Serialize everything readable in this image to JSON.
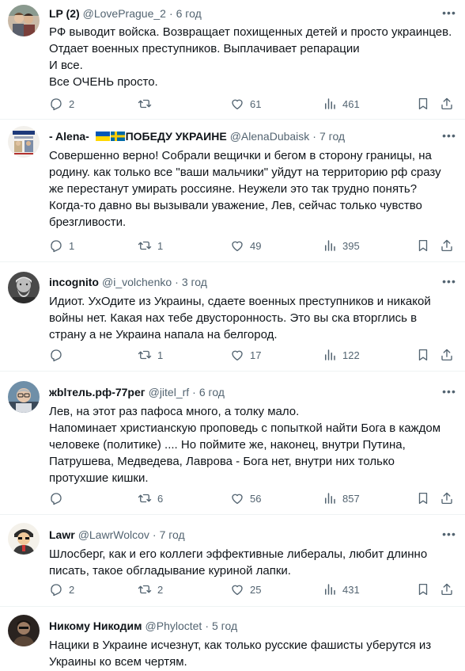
{
  "tweets": [
    {
      "name": "LP (2)",
      "handle": "@LovePrague_2",
      "time": "6 год",
      "text": "РФ выводит войска. Возвращает похищенных детей и просто украинцев.\nОтдает военных преступников. Выплачивает репарации\nИ все.\nВсе ОЧЕНЬ просто.",
      "replies": "2",
      "retweets": "",
      "likes": "61",
      "views": "461",
      "avatar": "avatar-couple"
    },
    {
      "name": "- Alena-",
      "name_suffix": "ПОБЕДУ УКРАИНЕ",
      "flags": [
        "ukraine-flag-icon",
        "sweden-flag-icon"
      ],
      "handle": "@AlenaDubaisk",
      "time": "7 год",
      "text": "Совершенно верно! Собрали вещички и бегом в сторону границы, на родину. как только все \"ваши мальчики\" уйдут на территорию рф сразу же перестанут умирать россияне. Неужели это так трудно понять? Когда-то давно вы вызывали уважение, Лев, сейчас только чувство брезгливости.",
      "replies": "1",
      "retweets": "1",
      "likes": "49",
      "views": "395",
      "avatar": "avatar-poster"
    },
    {
      "name": "incognito",
      "handle": "@i_volchenko",
      "time": "3 год",
      "text": "Идиот. УхОдите из Украины, сдаете военных преступников и никакой войны нет. Какая нах тебе двусторонность. Это вы ска вторглись в страну а не Украина напала на белгород.",
      "replies": "",
      "retweets": "1",
      "likes": "17",
      "views": "122",
      "avatar": "avatar-bearded-man"
    },
    {
      "name": "жblтель.рф-77рег",
      "handle": "@jitel_rf",
      "time": "6 год",
      "text": "Лев, на этот раз пафоса много, а толку мало.\nНапоминает христианскую проповедь с попыткой найти Бога в каждом человеке (политике) .... Но поймите же, наконец, внутри Путина, Патрушева, Медведева, Лаврова - Бога нет, внутри них только протухшие кишки.",
      "replies": "",
      "retweets": "6",
      "likes": "56",
      "views": "857",
      "avatar": "avatar-man-glasses"
    },
    {
      "name": "Lawr",
      "handle": "@LawrWolcov",
      "time": "7 год",
      "text": "Шлосберг, как и его коллеги эффективные либералы, любит длинно писать, такое обгладывание куриной лапки.",
      "replies": "2",
      "retweets": "2",
      "likes": "25",
      "views": "431",
      "avatar": "avatar-cartoon"
    },
    {
      "name": "Никому Никодим",
      "handle": "@Phyloctet",
      "time": "5 год",
      "text": "Нацики в Украине исчезнут, как только русские фашисты уберутся из Украины ко всем чертям.",
      "replies": "",
      "retweets": "",
      "likes": "",
      "views": "",
      "avatar": "avatar-dark"
    }
  ],
  "dot": "·",
  "icons": {
    "reply": "reply-icon",
    "retweet": "retweet-icon",
    "like": "heart-icon",
    "views": "views-icon",
    "bookmark": "bookmark-icon",
    "share": "share-icon",
    "more": "more-icon"
  },
  "colors": {
    "text": "#0f1419",
    "secondary": "#536471",
    "divider": "#eff3f4"
  }
}
